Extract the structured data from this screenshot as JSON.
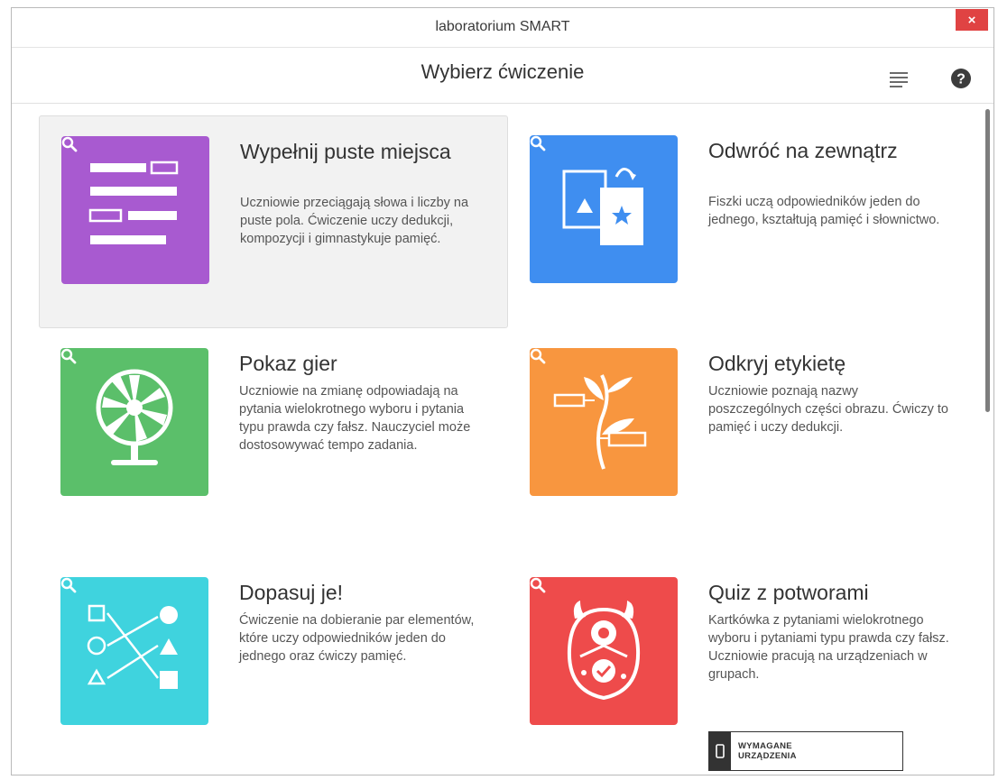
{
  "window": {
    "title": "laboratorium SMART",
    "close_label": "×"
  },
  "header": {
    "heading": "Wybierz ćwiczenie"
  },
  "icons": {
    "menu": "menu-icon",
    "help": "help-icon",
    "zoom": "magnifier-icon"
  },
  "colors": {
    "purple": "#a85ad0",
    "blue": "#3f8ef0",
    "green": "#5bbf6a",
    "orange": "#f8963f",
    "cyan": "#3fd3de",
    "red": "#ee4b4b",
    "close": "#e04343"
  },
  "cards": [
    {
      "title": "Wypełnij puste miejsca",
      "description": "Uczniowie przeciągają słowa i liczby na puste pola. Ćwiczenie uczy dedukcji, kompozycji i gimnastykuje pamięć.",
      "selected": true,
      "icon": "fill-blanks-icon"
    },
    {
      "title": "Odwróć na zewnątrz",
      "description": "Fiszki uczą odpowiedników jeden do jednego, kształtują pamięć i słownictwo.",
      "selected": false,
      "icon": "flip-cards-icon"
    },
    {
      "title": "Pokaz gier",
      "description": "Uczniowie na zmianę odpowiadają na pytania wielokrotnego wyboru i pytania typu prawda czy fałsz. Nauczyciel może dostosowywać tempo zadania.",
      "selected": false,
      "icon": "game-wheel-icon"
    },
    {
      "title": "Odkryj etykietę",
      "description": "Uczniowie poznają nazwy poszczególnych części obrazu. Ćwiczy to pamięć i uczy dedukcji.",
      "selected": false,
      "icon": "label-plant-icon"
    },
    {
      "title": "Dopasuj je!",
      "description": "Ćwiczenie na dobieranie par elementów, które uczy odpowiedników jeden do jednego oraz ćwiczy pamięć.",
      "selected": false,
      "icon": "match-shapes-icon"
    },
    {
      "title": "Quiz z potworami",
      "description": "Kartkówka z pytaniami wielokrotnego wyboru i pytaniami typu prawda czy fałsz. Uczniowie pracują na urządzeniach w grupach.",
      "selected": false,
      "icon": "monster-icon",
      "badge": {
        "line1": "WYMAGANE",
        "line2": "URZĄDZENIA"
      }
    }
  ]
}
